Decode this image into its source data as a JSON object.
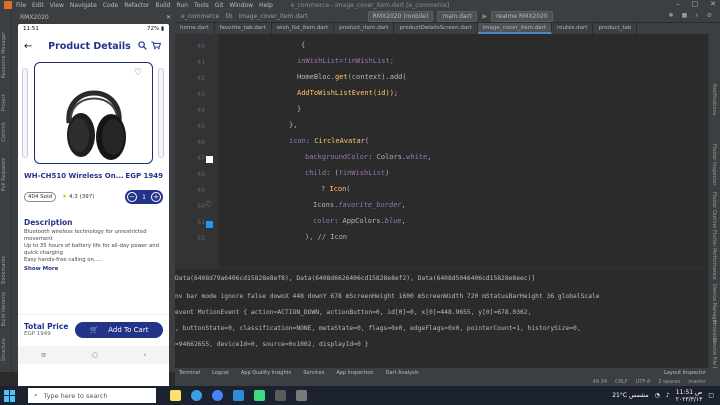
{
  "menu": {
    "items": [
      "File",
      "Edit",
      "View",
      "Navigate",
      "Code",
      "Refactor",
      "Build",
      "Run",
      "Tools",
      "Git",
      "Window",
      "Help"
    ],
    "window_title": "e_commerce - image_cover_item.dart [e_commerce]"
  },
  "toolbar": {
    "breadcrumbs": [
      "e_commerce",
      "lib",
      "image_cover_item.dart"
    ],
    "device": "RMX2020 (mobile)",
    "run_config": "main.dart",
    "git_branch": "realme RMX2020"
  },
  "tabs": [
    "home.dart",
    "favorite_tab.dart",
    "wish_list_item.dart",
    "product_item.dart",
    "productDetailsScreen.dart",
    "image_cover_item.dart",
    "routes.dart",
    "product_tab"
  ],
  "emulator": {
    "title": "RMX2020"
  },
  "phone": {
    "time": "11:51",
    "battery": "72% ▮",
    "screen_title": "Product Details",
    "product_name": "WH-CH510 Wireless On...",
    "price": "EGP 1949",
    "sold": "404 Sold",
    "rating": "4.3 (397)",
    "quantity": "1",
    "description_title": "Description",
    "description_lines": [
      "Bluetooth wireless technology for unrestricted movement",
      "Up to 35 hours of battery life for all-day power and quick charging",
      "Easy hands-free calling on....."
    ],
    "show_more": "Show More",
    "total_label": "Total Price",
    "total_value": "EGP 1949",
    "add_to_cart": "Add To Cart"
  },
  "code": {
    "line_numbers": [
      "40",
      "41",
      "42",
      "43",
      "44",
      "45",
      "46",
      "47",
      "48",
      "49",
      "50",
      "51",
      "52"
    ],
    "lines": [
      "{",
      "inWishList=!inWishList;",
      "HomeBloc.get(context).add(",
      "AddToWishListEvent(id));",
      "}",
      "},",
      "icon: CircleAvatar(",
      "backgroundColor: Colors.white,",
      "child: (!inWishList)",
      "? Icon(",
      "Icons.favorite_border,",
      "color: AppColors.blue,",
      "), // Icon"
    ]
  },
  "console": {
    "lines": [
      "Data(6408d79a6406cd15828e8ef8), Data(6408d6626406cd15828e8ef2), Data(6408d5046406cd15828e8eec)]",
      "nv bar mode ignore false downX 448 downY 678 mScreenHeight 1600 mScreenWidth 720 mStatusBarHeight 36 globalScale",
      "event MotionEvent { action=ACTION_DOWN, actionButton=0, id[0]=0, x[0]=448.9655, y[0]=678.0362,",
      ", buttonState=0, classification=NONE, metaState=0, flags=0x0, edgeFlags=0x0, pointerCount=1, historySize=0,",
      "=94662655, deviceId=0, source=0x1002, displayId=0 }"
    ]
  },
  "bottom_tools": [
    "Terminal",
    "Logcat",
    "App Quality Insights",
    "Services",
    "App Inspection",
    "Dart Analysis",
    "Layout Inspector"
  ],
  "status_bar": [
    "46:34",
    "CRLF",
    "UTF-8",
    "2 spaces",
    "master"
  ],
  "left_strip": [
    "Resource Manager",
    "Project",
    "Commit",
    "Pull Requests",
    "Bookmarks",
    "Build Variants",
    "Structure"
  ],
  "right_strip": [
    "Notifications",
    "Flutter Inspector",
    "Flutter Outline",
    "Flutter Performance",
    "Device Manager",
    "Emulator",
    "Device File Explorer"
  ],
  "taskbar": {
    "search_placeholder": "Type here to search",
    "weather": "21°C  مشمس",
    "time": "11:51 ص",
    "date": "٢٠٢٣/٣/١٣"
  }
}
